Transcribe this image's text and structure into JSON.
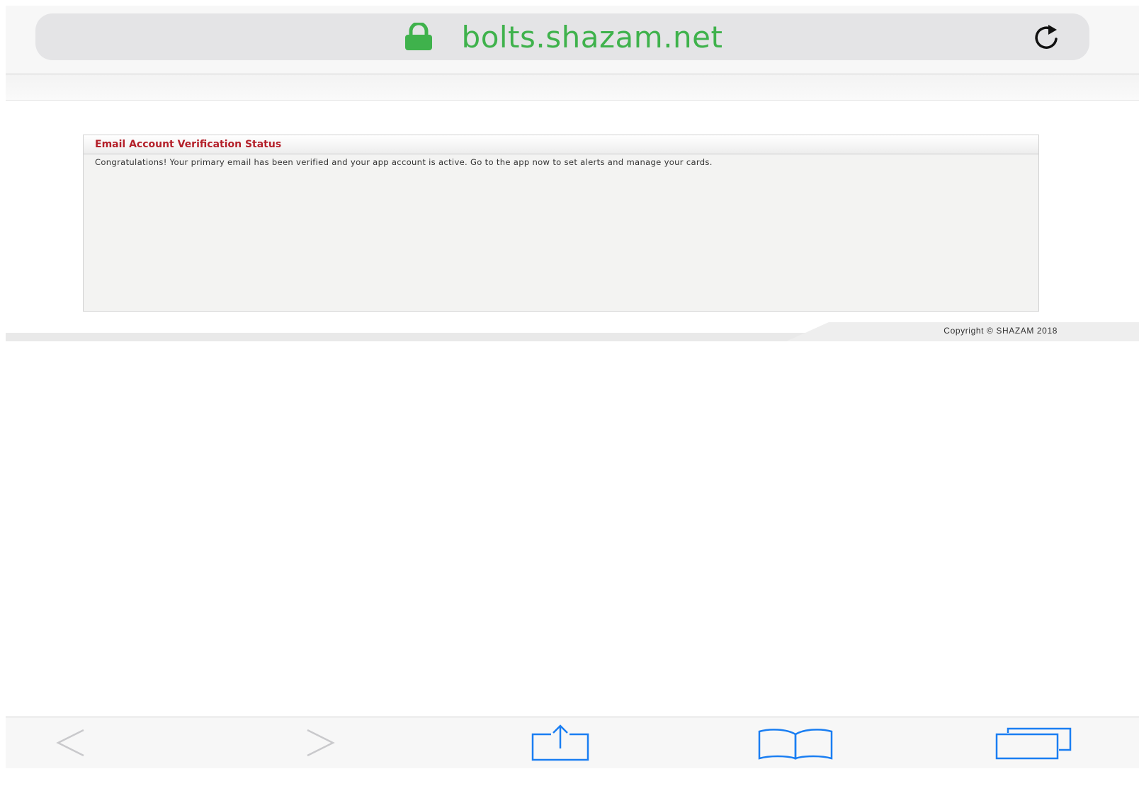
{
  "browser": {
    "url": "bolts.shazam.net",
    "url_color": "#3fb24c",
    "icons": {
      "lock": "lock-icon",
      "reload": "reload-icon",
      "back": "back-chevron-icon",
      "forward": "forward-chevron-icon",
      "share": "share-icon",
      "bookmarks": "bookmarks-icon",
      "tabs": "tabs-icon"
    },
    "accent_color": "#1a7ef2"
  },
  "panel": {
    "title": "Email Account Verification Status",
    "title_color": "#b4202a",
    "message": "Congratulations! Your primary email has been verified and your app account is active. Go to the app now to set alerts and manage your cards."
  },
  "footer": {
    "copyright": "Copyright © SHAZAM 2018"
  }
}
